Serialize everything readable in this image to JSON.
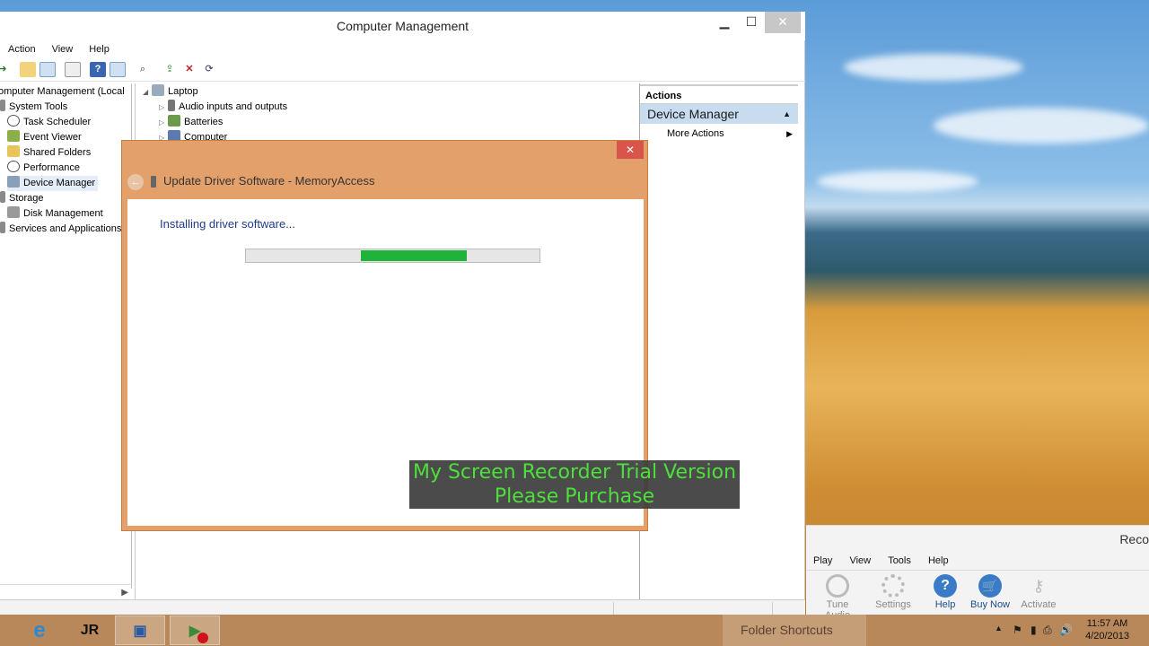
{
  "cm_window": {
    "title": "Computer Management",
    "controls": {
      "minimize": "▁",
      "maximize": "☐",
      "close": "✕"
    },
    "menu": [
      "Action",
      "View",
      "Help"
    ]
  },
  "tree": {
    "items": [
      {
        "label": "omputer Management (Local",
        "icon": "computer-icon"
      },
      {
        "label": "System Tools",
        "icon": "tools-icon"
      },
      {
        "label": "Task Scheduler",
        "icon": "clock-icon"
      },
      {
        "label": "Event Viewer",
        "icon": "event-viewer-icon"
      },
      {
        "label": "Shared Folders",
        "icon": "shared-folder-icon"
      },
      {
        "label": "Performance",
        "icon": "performance-icon"
      },
      {
        "label": "Device Manager",
        "icon": "device-manager-icon"
      },
      {
        "label": "Storage",
        "icon": "storage-icon"
      },
      {
        "label": "Disk Management",
        "icon": "disk-icon"
      },
      {
        "label": "Services and Applications",
        "icon": "services-icon"
      }
    ]
  },
  "device_list": {
    "root": "Laptop",
    "items": [
      "Audio inputs and outputs",
      "Batteries",
      "Computer"
    ]
  },
  "actions": {
    "header": "Actions",
    "selected": "Device Manager",
    "items": [
      "More Actions"
    ]
  },
  "dialog": {
    "title": "Update Driver Software - MemoryAccess",
    "status": "Installing driver software...",
    "progress_fill_start": 0.39,
    "progress_fill_end": 0.75,
    "close": "✕"
  },
  "watermark": {
    "line1": "My Screen Recorder Trial Version",
    "line2": "Please Purchase"
  },
  "recorder": {
    "title": "Reco",
    "menu": [
      "Play",
      "View",
      "Tools",
      "Help"
    ],
    "tools": [
      {
        "label": "Tune Audio",
        "icon": "headphones-icon",
        "enabled": false
      },
      {
        "label": "Settings",
        "icon": "gear-icon",
        "enabled": false
      },
      {
        "label": "Help",
        "icon": "help-icon",
        "enabled": true
      },
      {
        "label": "Buy Now",
        "icon": "cart-icon",
        "enabled": true
      },
      {
        "label": "Activate",
        "icon": "key-icon",
        "enabled": false
      }
    ]
  },
  "taskbar": {
    "folder_shortcuts": "Folder Shortcuts",
    "time": "11:57 AM",
    "date": "4/20/2013"
  },
  "colors": {
    "dialog_frame": "#e3a06a",
    "progress_fill": "#1fb33a",
    "watermark_text": "#4ddf3b",
    "actions_selected": "#c8dcef"
  }
}
